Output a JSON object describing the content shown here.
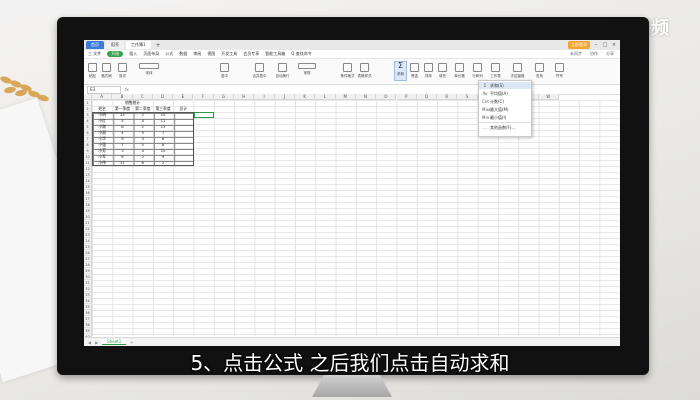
{
  "brand": {
    "logo_text": "天奇·视频"
  },
  "subtitle": "5、点击公式 之后我们点击自动求和",
  "window": {
    "tabs": [
      {
        "label": "首页"
      },
      {
        "label": "稻壳"
      },
      {
        "label": "工作簿1"
      }
    ],
    "login_label": "立即登录"
  },
  "menubar": {
    "items": [
      "三 文件",
      "开始",
      "插入",
      "页面布局",
      "公式",
      "数据",
      "审阅",
      "视图",
      "开发工具",
      "会员专享",
      "智能工具箱"
    ],
    "active_index": 1,
    "search_hint": "Q 查找命令",
    "right": [
      "未同步",
      "协作",
      "分享"
    ]
  },
  "ribbon": {
    "buttons": [
      "粘贴",
      "格式刷",
      "剪切",
      "宋体",
      "居中",
      "合并居中",
      "自动换行",
      "常规",
      "条件格式",
      "表格样式",
      "求和",
      "筛选",
      "排序",
      "填充",
      "单元格",
      "行和列",
      "工作表",
      "冻结窗格",
      "查找",
      "符号"
    ],
    "selected_label": "求和"
  },
  "formula_bar": {
    "name_box": "E3",
    "fx": "fx"
  },
  "columns": [
    "A",
    "B",
    "C",
    "D",
    "E",
    "F",
    "G",
    "H",
    "I",
    "J",
    "K",
    "L",
    "M",
    "N",
    "O",
    "P",
    "Q",
    "R",
    "S",
    "T",
    "U",
    "V",
    "W"
  ],
  "rows": [
    "1",
    "2",
    "3",
    "4",
    "5",
    "6",
    "7",
    "8",
    "9",
    "10",
    "11",
    "12",
    "13",
    "14",
    "15",
    "16",
    "17",
    "18",
    "19",
    "20",
    "21",
    "22",
    "23",
    "24",
    "25",
    "26",
    "27",
    "28",
    "29",
    "30",
    "31",
    "32",
    "33",
    "34",
    "35",
    "36",
    "37",
    "38",
    "39",
    "40"
  ],
  "table": {
    "title": "销售统计",
    "headers": [
      "姓名",
      "第一季度",
      "第二季度",
      "第三季度",
      "总计"
    ],
    "rows": [
      [
        "小明",
        "24",
        "2",
        "10"
      ],
      [
        "小红",
        "5",
        "4",
        "11"
      ],
      [
        "小刚",
        "8",
        "2",
        "13"
      ],
      [
        "小丽",
        "4",
        "5",
        "7"
      ],
      [
        "小华",
        "9",
        "3",
        "6"
      ],
      [
        "小强",
        "7",
        "5",
        "8"
      ],
      [
        "小芳",
        "3",
        "4",
        "10"
      ],
      [
        "小军",
        "6",
        "2",
        "9"
      ],
      [
        "小伟",
        "31",
        "6",
        "2"
      ]
    ]
  },
  "dropdown": {
    "items": [
      {
        "icon": "Σ",
        "label": "求和(S)"
      },
      {
        "icon": "Av",
        "label": "平均值(A)"
      },
      {
        "icon": "Cnt",
        "label": "计数(C)"
      },
      {
        "icon": "Max",
        "label": "最大值(M)"
      },
      {
        "icon": "Min",
        "label": "最小值(I)"
      },
      {
        "icon": "…",
        "label": "其他函数(F)..."
      }
    ]
  },
  "sheetbar": {
    "sheet_name": "Sheet1"
  }
}
